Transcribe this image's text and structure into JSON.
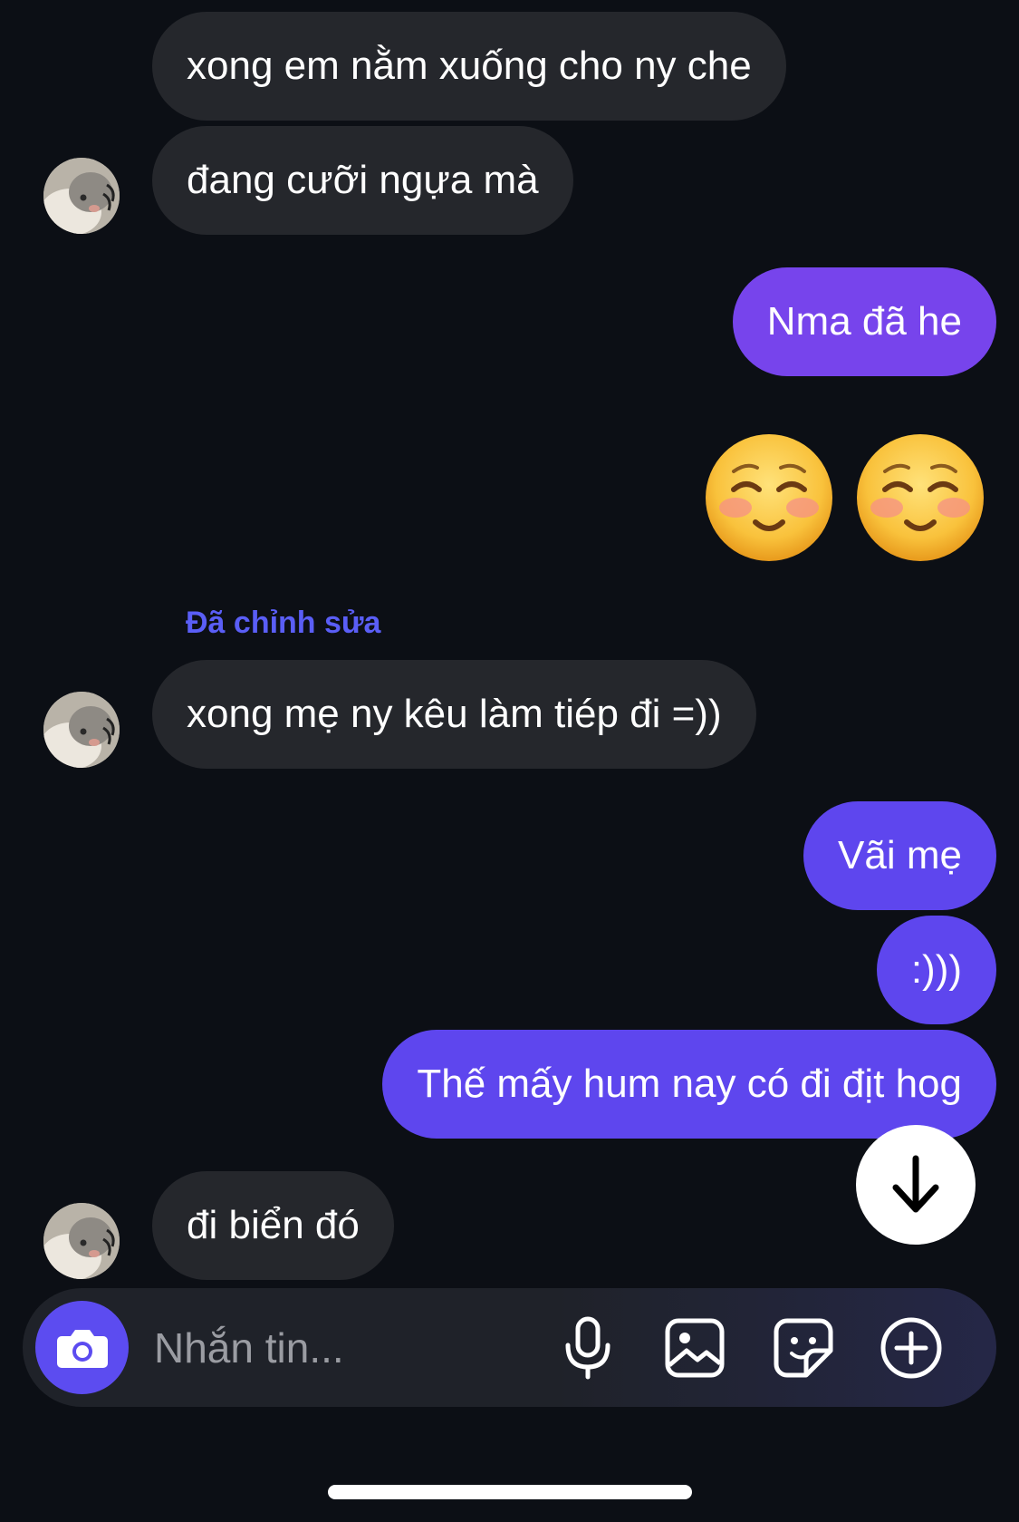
{
  "colors": {
    "background": "#0c0f15",
    "incoming_bubble": "#25272c",
    "outgoing_bubble": "#5e46ee",
    "accent": "#5c4cf0",
    "edited_label": "#5a5ef6"
  },
  "messages": [
    {
      "direction": "incoming",
      "text": "xong em nằm xuống cho ny che"
    },
    {
      "direction": "incoming",
      "text": "đang cưỡi ngựa mà"
    },
    {
      "direction": "outgoing",
      "text": "Nma đã he"
    },
    {
      "direction": "outgoing",
      "emoji": "smiling-face-icon"
    },
    {
      "direction": "outgoing",
      "emoji": "smiling-face-icon"
    },
    {
      "direction": "incoming",
      "text": "xong mẹ ny kêu làm tiép đi =))",
      "edited_label": "Đã chỉnh sửa"
    },
    {
      "direction": "outgoing",
      "text": "Vãi mẹ"
    },
    {
      "direction": "outgoing",
      "text": ":)))"
    },
    {
      "direction": "outgoing",
      "text": "Thế mấy hum nay có đi địt hog"
    },
    {
      "direction": "incoming",
      "text": "đi biển đó"
    }
  ],
  "composer": {
    "placeholder": "Nhắn tin...",
    "icons": [
      "camera-icon",
      "microphone-icon",
      "image-icon",
      "sticker-icon",
      "plus-circle-icon"
    ]
  },
  "scroll_button_icon": "arrow-down-icon"
}
